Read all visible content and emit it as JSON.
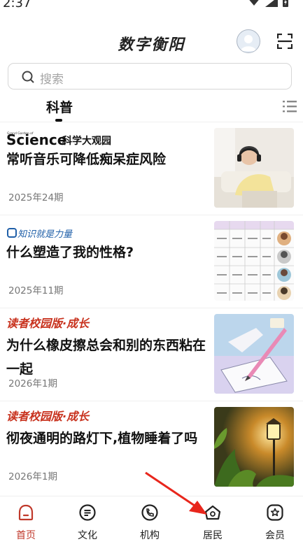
{
  "status_bar": {
    "time": "2:37"
  },
  "header": {
    "title": "数字衡阳"
  },
  "search": {
    "placeholder": "搜索"
  },
  "tabs": [
    {
      "label": "科普",
      "active": true
    }
  ],
  "articles": [
    {
      "source": "Science科学大观园",
      "title": "常听音乐可降低痴呆症风险",
      "date": "2025年24期"
    },
    {
      "source": "知识就是力量",
      "title": "什么塑造了我的性格?",
      "date": "2025年11期"
    },
    {
      "source": "读者校园版·成长",
      "title": "为什么橡皮擦总会和别的东西粘在一起",
      "date": "2026年1期"
    },
    {
      "source": "读者校园版·成长",
      "title": "彻夜通明的路灯下,植物睡着了吗",
      "date": "2026年1期"
    }
  ],
  "bottom_nav": [
    {
      "label": "首页",
      "icon": "home-icon",
      "active": true
    },
    {
      "label": "文化",
      "icon": "culture-icon",
      "active": false
    },
    {
      "label": "机构",
      "icon": "organization-icon",
      "active": false
    },
    {
      "label": "居民",
      "icon": "residents-icon",
      "active": false
    },
    {
      "label": "会员",
      "icon": "member-icon",
      "active": false
    }
  ],
  "colors": {
    "accent": "#c0392b",
    "source_red": "#c8321e",
    "annotation_arrow": "#e8261c"
  }
}
